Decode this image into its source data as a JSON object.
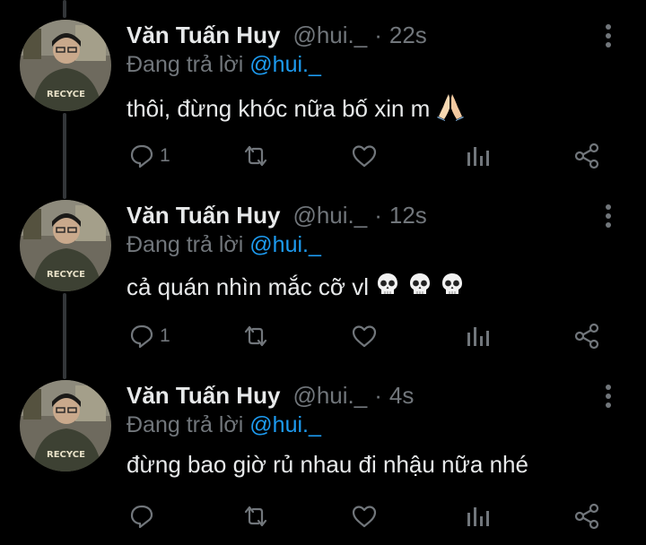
{
  "tweets": [
    {
      "author_name": "Văn Tuấn Huy",
      "handle": "@hui._",
      "separator": "·",
      "time": "22s",
      "replying_label": "Đang trả lời",
      "replying_to": "@hui._",
      "text": "thôi, đừng khóc nữa bố xin m",
      "emojis": [
        "folded-hands"
      ],
      "reply_count": "1"
    },
    {
      "author_name": "Văn Tuấn Huy",
      "handle": "@hui._",
      "separator": "·",
      "time": "12s",
      "replying_label": "Đang trả lời",
      "replying_to": "@hui._",
      "text": "cả quán nhìn mắc cỡ vl",
      "emojis": [
        "skull",
        "skull",
        "skull"
      ],
      "reply_count": "1"
    },
    {
      "author_name": "Văn Tuấn Huy",
      "handle": "@hui._",
      "separator": "·",
      "time": "4s",
      "replying_label": "Đang trả lời",
      "replying_to": "@hui._",
      "text": "đừng bao giờ rủ nhau đi nhậu nữa nhé",
      "emojis": [],
      "reply_count": ""
    }
  ],
  "avatar_text": "RECYCE",
  "icons": [
    "more-vertical-icon",
    "reply-icon",
    "retweet-icon",
    "like-icon",
    "views-icon",
    "share-icon"
  ],
  "colors": {
    "background": "#000000",
    "primary_text": "#e7e9ea",
    "secondary_text": "#71767b",
    "mention": "#1d9bf0",
    "thread_line": "#333639"
  }
}
